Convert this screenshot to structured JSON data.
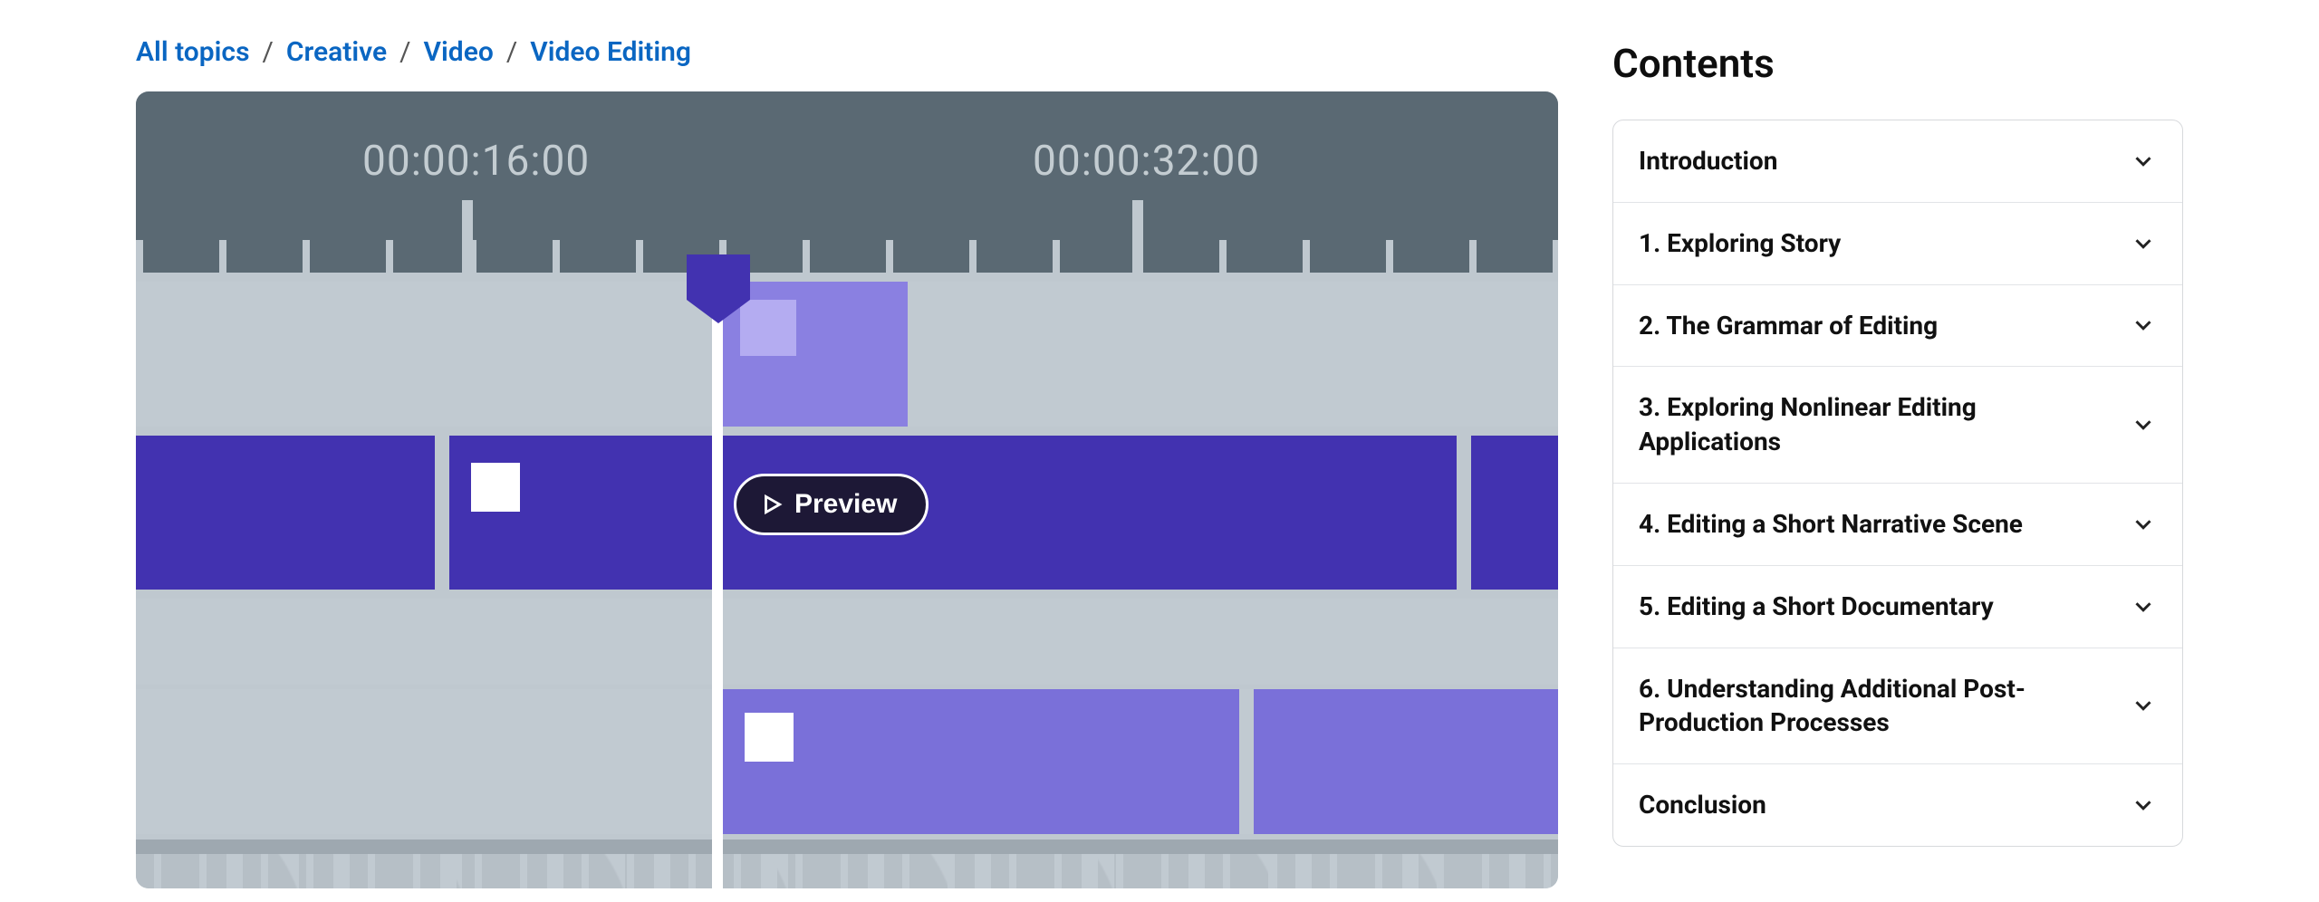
{
  "breadcrumb": [
    {
      "label": "All topics"
    },
    {
      "label": "Creative"
    },
    {
      "label": "Video"
    },
    {
      "label": "Video Editing"
    }
  ],
  "hero": {
    "timecode1": "00:00:16:00",
    "timecode2": "00:00:32:00",
    "preview_label": "Preview"
  },
  "sidebar": {
    "title": "Contents",
    "items": [
      {
        "label": "Introduction"
      },
      {
        "label": "1. Exploring Story"
      },
      {
        "label": "2. The Grammar of Editing"
      },
      {
        "label": "3. Exploring Nonlinear Editing Applications"
      },
      {
        "label": "4. Editing a Short Narrative Scene"
      },
      {
        "label": "5. Editing a Short Documentary"
      },
      {
        "label": "6. Understanding Additional Post-Production Processes"
      },
      {
        "label": "Conclusion"
      }
    ]
  }
}
